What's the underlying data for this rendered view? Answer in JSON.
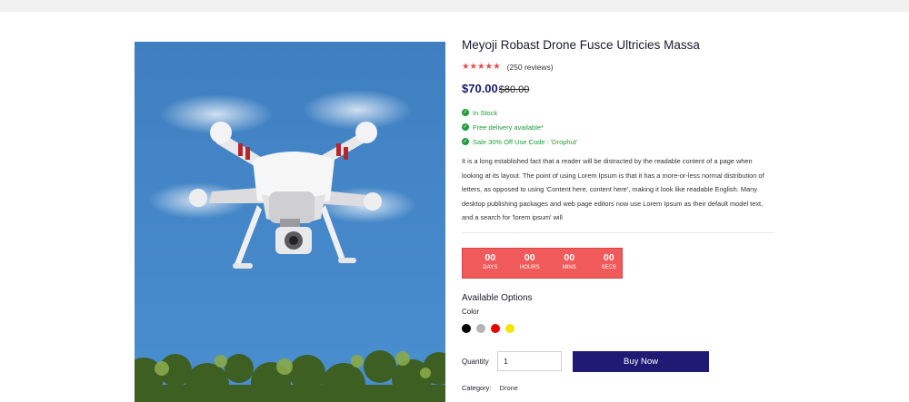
{
  "product": {
    "title": "Meyoji Robast Drone Fusce Ultricies Massa",
    "stars": "★★★★★",
    "reviews": "(250 reviews)",
    "price": "$70.00",
    "old_price": "$80.00",
    "features": [
      {
        "text": "In Stock"
      },
      {
        "text": "Free delivery available*"
      },
      {
        "text": "Sale 30% Off Use Code : 'Drophut'"
      }
    ],
    "description": "It is a long established fact that a reader will be distracted by the readable content of a page when looking at its layout. The point of using Lorem Ipsum is that it has a more-or-less normal distribution of letters, as opposed to using 'Content here, content here', making it look like readable English. Many desktop publishing packages and web page editors now use Lorem Ipsum as their default model text, and a search for 'lorem ipsum' will"
  },
  "countdown": [
    {
      "value": "00",
      "label": "DAYS"
    },
    {
      "value": "00",
      "label": "HOURS"
    },
    {
      "value": "00",
      "label": "MINS"
    },
    {
      "value": "00",
      "label": "SECS"
    }
  ],
  "options": {
    "title": "Available Options",
    "color_label": "Color",
    "colors": [
      "#000000",
      "#b3b3b3",
      "#e60000",
      "#f2e600"
    ]
  },
  "quantity": {
    "label": "Quantity",
    "value": "1"
  },
  "buy_label": "Buy Now",
  "category": {
    "label": "Category:",
    "value": "Drone"
  },
  "colors": {
    "accent": "#1f1b75",
    "countdown_bg": "#f05a5a",
    "stock_green": "#1f9d3a",
    "star_red": "#e94b4b"
  }
}
